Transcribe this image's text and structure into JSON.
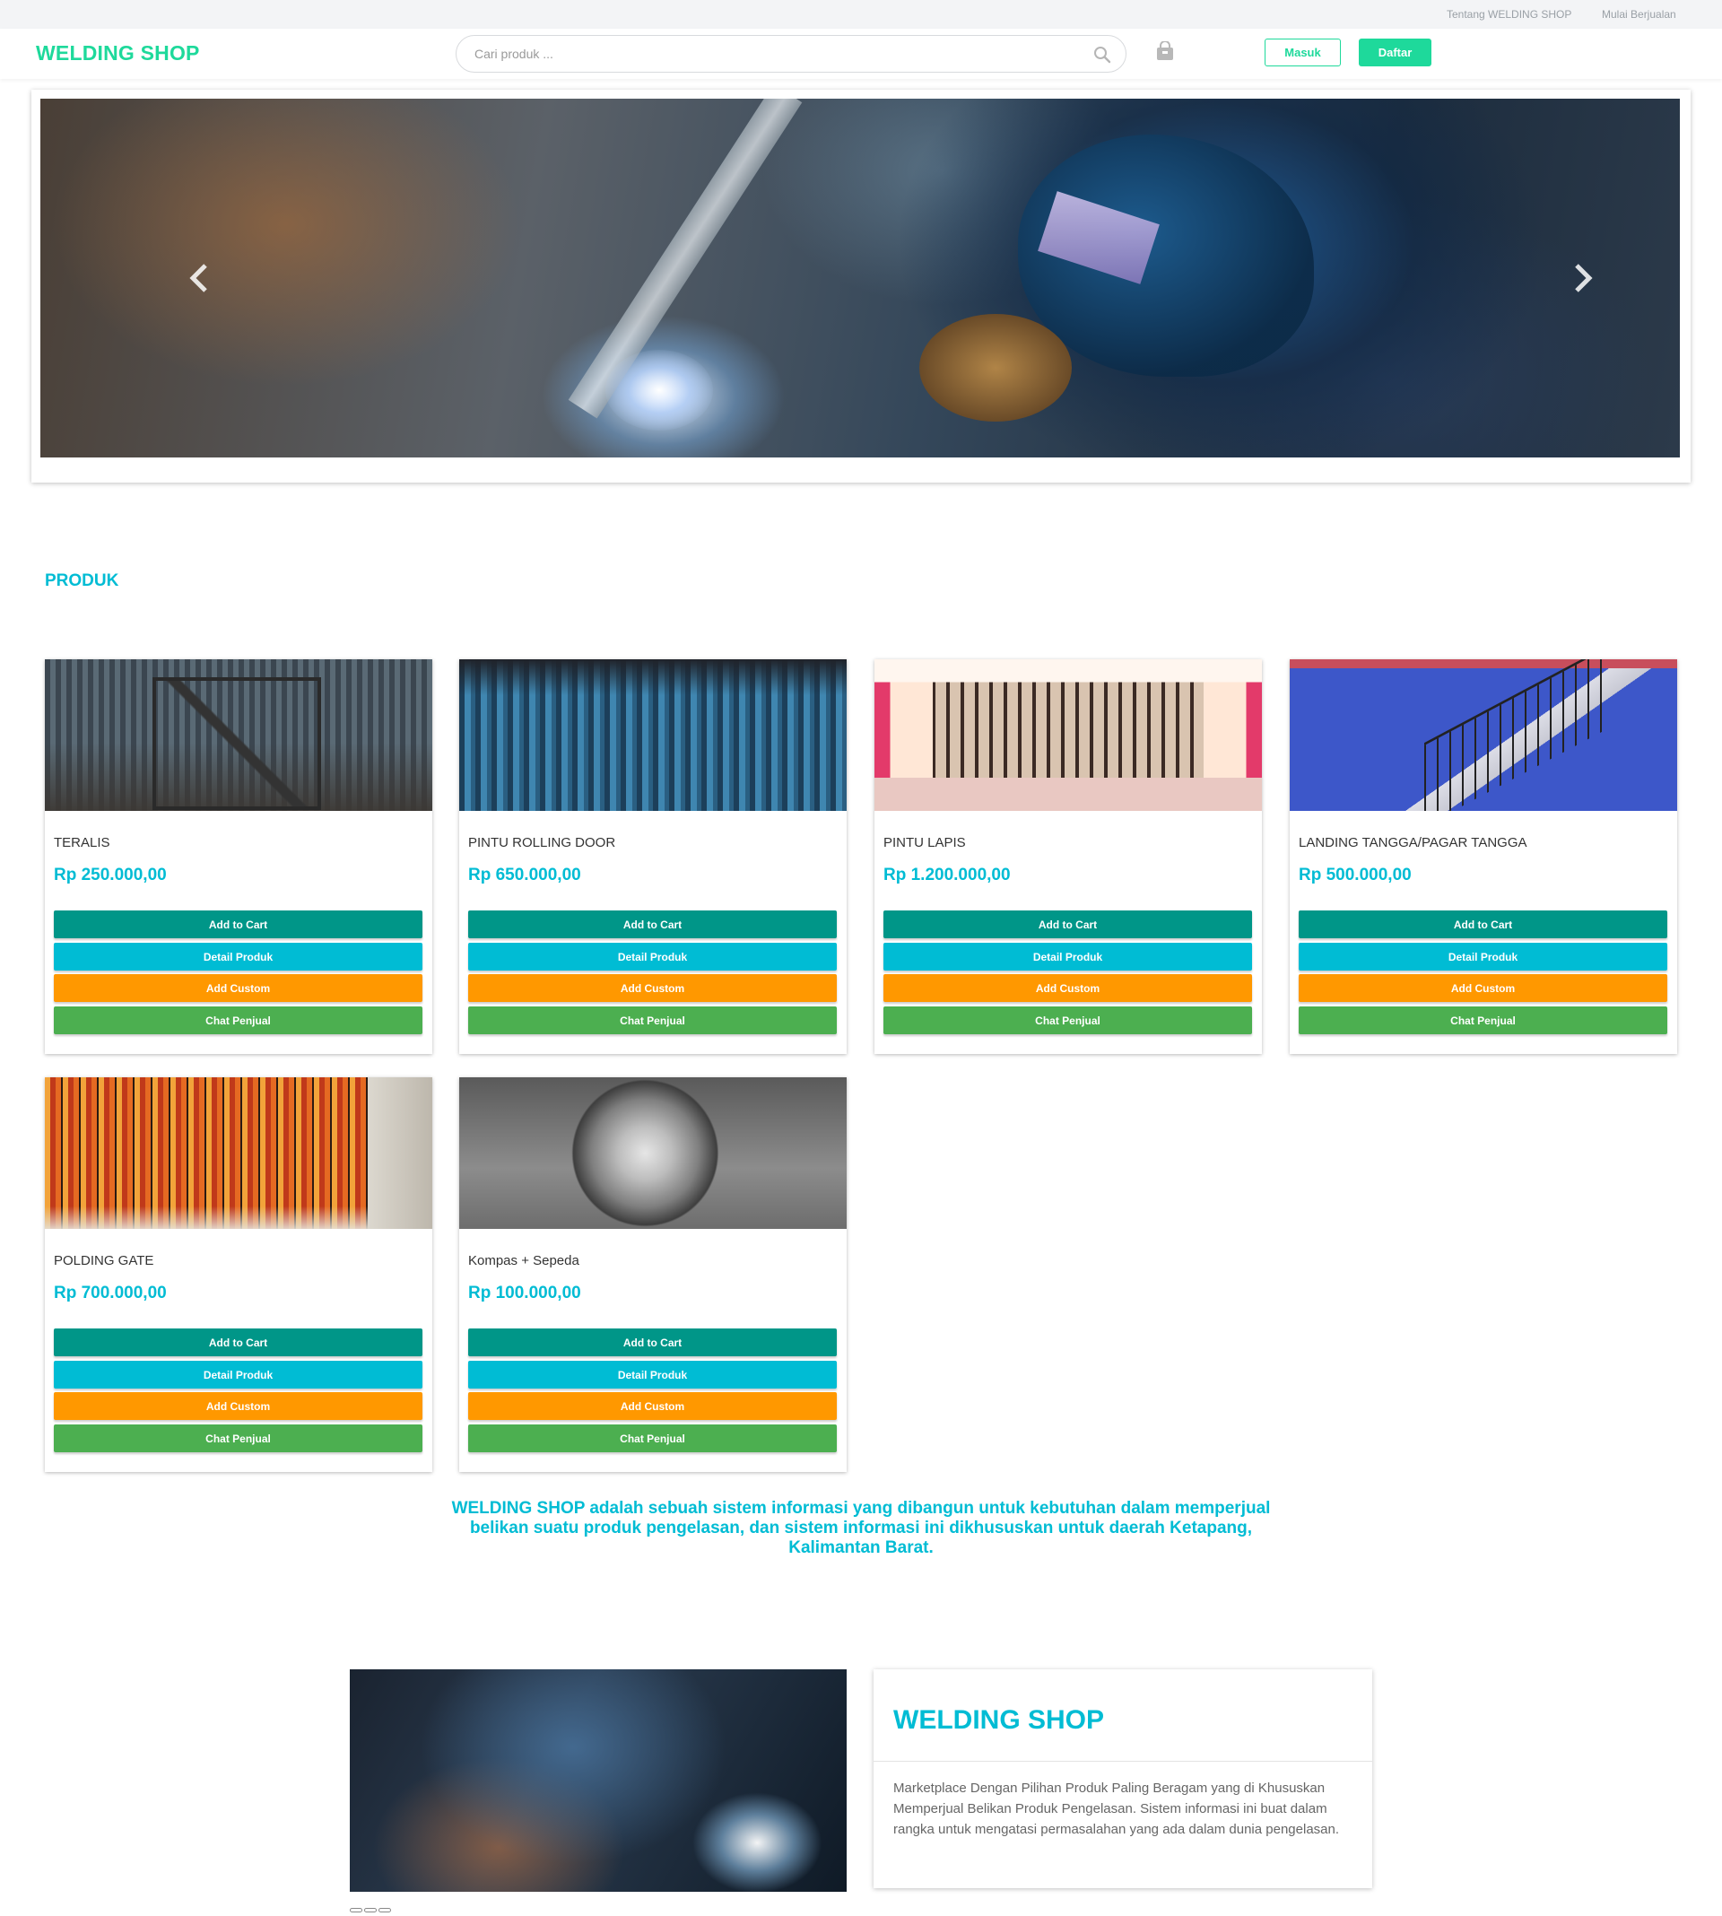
{
  "topbar": {
    "about_link": "Tentang WELDING SHOP",
    "sell_link": "Mulai Berjualan"
  },
  "header": {
    "logo": "WELDING SHOP",
    "search_placeholder": "Cari produk ...",
    "login_label": "Masuk",
    "register_label": "Daftar"
  },
  "icons": {
    "search": "search-icon",
    "cart": "shopping-bag-icon",
    "prev": "chevron-left-icon",
    "next": "chevron-right-icon"
  },
  "section_title": "PRODUK",
  "buttons": {
    "cart": "Add to Cart",
    "detail": "Detail Produk",
    "custom": "Add Custom",
    "chat": "Chat Penjual"
  },
  "products": [
    {
      "name": "TERALIS",
      "price": "Rp 250.000,00"
    },
    {
      "name": "PINTU ROLLING DOOR",
      "price": "Rp 650.000,00"
    },
    {
      "name": "PINTU LAPIS",
      "price": "Rp 1.200.000,00"
    },
    {
      "name": "LANDING TANGGA/PAGAR TANGGA",
      "price": "Rp 500.000,00"
    },
    {
      "name": "POLDING GATE",
      "price": "Rp 700.000,00"
    },
    {
      "name": "Kompas + Sepeda",
      "price": "Rp 100.000,00"
    }
  ],
  "about_text": "WELDING SHOP adalah sebuah sistem informasi yang dibangun untuk kebutuhan dalam memperjual belikan suatu produk pengelasan, dan sistem informasi ini dikhususkan untuk daerah Ketapang, Kalimantan Barat.",
  "info": {
    "title": "WELDING SHOP",
    "description": "Marketplace Dengan Pilihan Produk Paling Beragam yang di Khususkan Memperjual Belikan Produk Pengelasan. Sistem informasi ini buat dalam rangka untuk mengatasi permasalahan yang ada dalam dunia pengelasan."
  },
  "colors": {
    "brand": "#1ed99b",
    "accent": "#00bcd4",
    "cart": "#009688",
    "custom": "#ff9800",
    "chat": "#4caf50"
  }
}
